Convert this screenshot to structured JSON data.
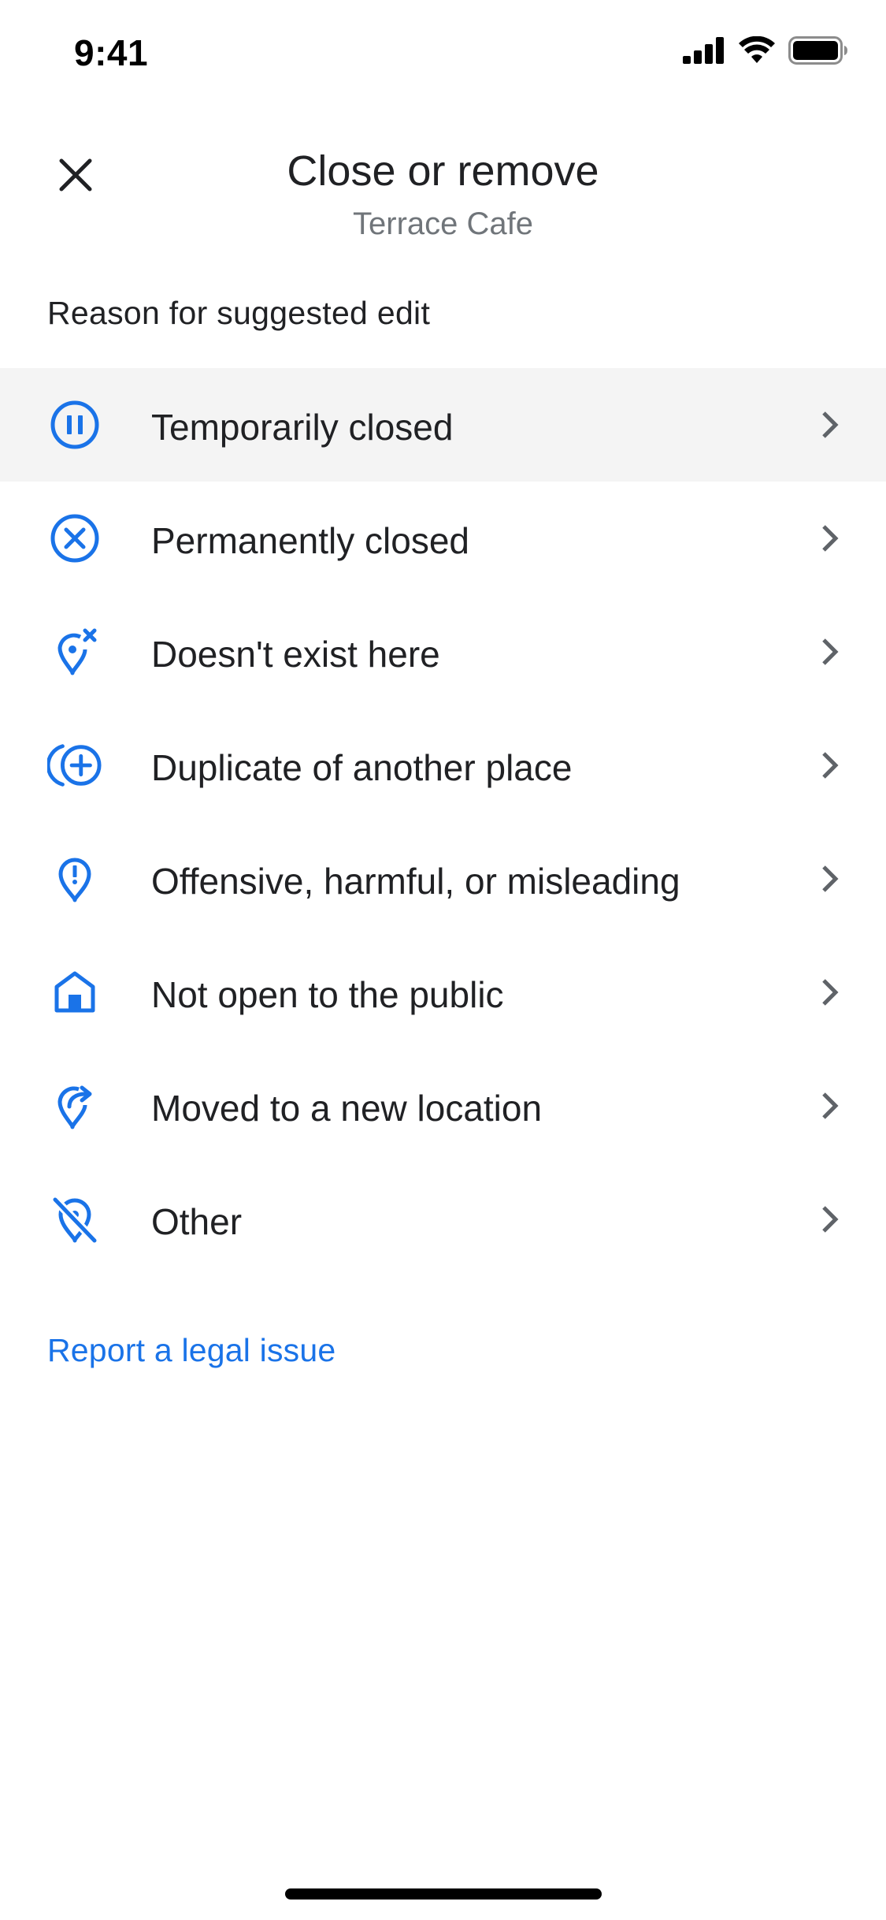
{
  "status_bar": {
    "time": "9:41",
    "icons": [
      "cellular-signal-icon",
      "wifi-icon",
      "battery-icon"
    ]
  },
  "header": {
    "title": "Close or remove",
    "subtitle": "Terrace Cafe",
    "close_icon": "close-icon"
  },
  "section": {
    "label": "Reason for suggested edit"
  },
  "reasons": [
    {
      "label": "Temporarily closed",
      "icon": "pause-circle-icon"
    },
    {
      "label": "Permanently closed",
      "icon": "cancel-circle-icon"
    },
    {
      "label": "Doesn't exist here",
      "icon": "location-remove-icon"
    },
    {
      "label": "Duplicate of another place",
      "icon": "duplicate-add-icon"
    },
    {
      "label": "Offensive, harmful, or misleading",
      "icon": "location-alert-icon"
    },
    {
      "label": "Not open to the public",
      "icon": "home-icon"
    },
    {
      "label": "Moved to a new location",
      "icon": "location-moved-icon"
    },
    {
      "label": "Other",
      "icon": "location-off-icon"
    }
  ],
  "footer": {
    "legal_link": "Report a legal issue"
  },
  "colors": {
    "accent": "#1a73e8",
    "text_primary": "#202124",
    "text_secondary": "#70757a",
    "highlight_row": "#f4f4f4",
    "chevron": "#5f6368"
  }
}
